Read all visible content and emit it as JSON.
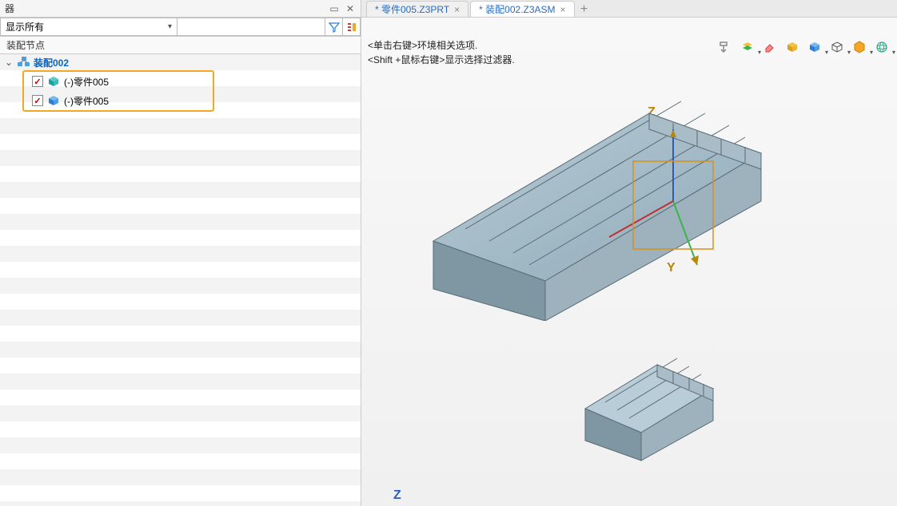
{
  "panel": {
    "title": "器",
    "filter_label": "显示所有",
    "subheader": "装配节点"
  },
  "tree": {
    "root": "装配002",
    "children": [
      {
        "label": "(-)零件005",
        "icon_color": "#1ba0a0"
      },
      {
        "label": "(-)零件005",
        "icon_color": "#2a7dd8"
      }
    ]
  },
  "tabs": [
    {
      "label": "* 零件005.Z3PRT",
      "active": false
    },
    {
      "label": "* 装配002.Z3ASM",
      "active": true
    }
  ],
  "hints": {
    "line1": "<单击右键>环境相关选项.",
    "line2": "<Shift +鼠标右键>显示选择过滤器."
  },
  "axes": {
    "z": "Z",
    "y": "Y",
    "z2": "Z"
  }
}
